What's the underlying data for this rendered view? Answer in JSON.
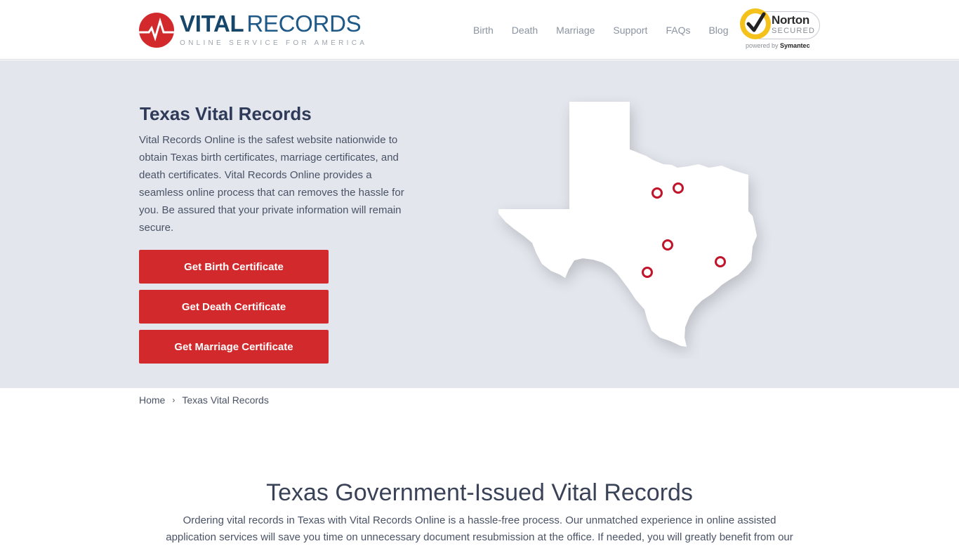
{
  "header": {
    "logo": {
      "title_bold": "VITAL",
      "title_regular": "RECORDS",
      "tagline": "ONLINE SERVICE FOR AMERICA"
    },
    "nav": [
      {
        "label": "Birth"
      },
      {
        "label": "Death"
      },
      {
        "label": "Marriage"
      },
      {
        "label": "Support"
      },
      {
        "label": "FAQs"
      },
      {
        "label": "Blog"
      }
    ],
    "badge": {
      "name": "Norton",
      "secured": "SECURED",
      "powered_by": "powered by",
      "vendor": "Symantec"
    }
  },
  "hero": {
    "title": "Texas Vital Records",
    "text": "Vital Records Online is the safest website nationwide to obtain Texas birth certificates, marriage certificates, and death certificates. Vital Records Online provides a seamless online process that can removes the hassle for you. Be assured that your private information will remain secure.",
    "buttons": {
      "birth": "Get Birth Certificate",
      "death": "Get Death Certificate",
      "marriage": "Get Marriage Certificate"
    },
    "map": {
      "state": "Texas",
      "marker_count": 5
    }
  },
  "breadcrumb": {
    "home": "Home",
    "current": "Texas Vital Records"
  },
  "section": {
    "title": "Texas Government-Issued Vital Records",
    "text": "Ordering vital records in Texas with Vital Records Online is a hassle-free process. Our unmatched experience in online assisted application services will save you time on unnecessary document resubmission at the office. If needed, you will greatly benefit from our"
  },
  "colors": {
    "brand_red": "#d22a2c",
    "brand_blue": "#17466b",
    "hero_bg": "#e3e6ed",
    "heading": "#2e3a57"
  }
}
